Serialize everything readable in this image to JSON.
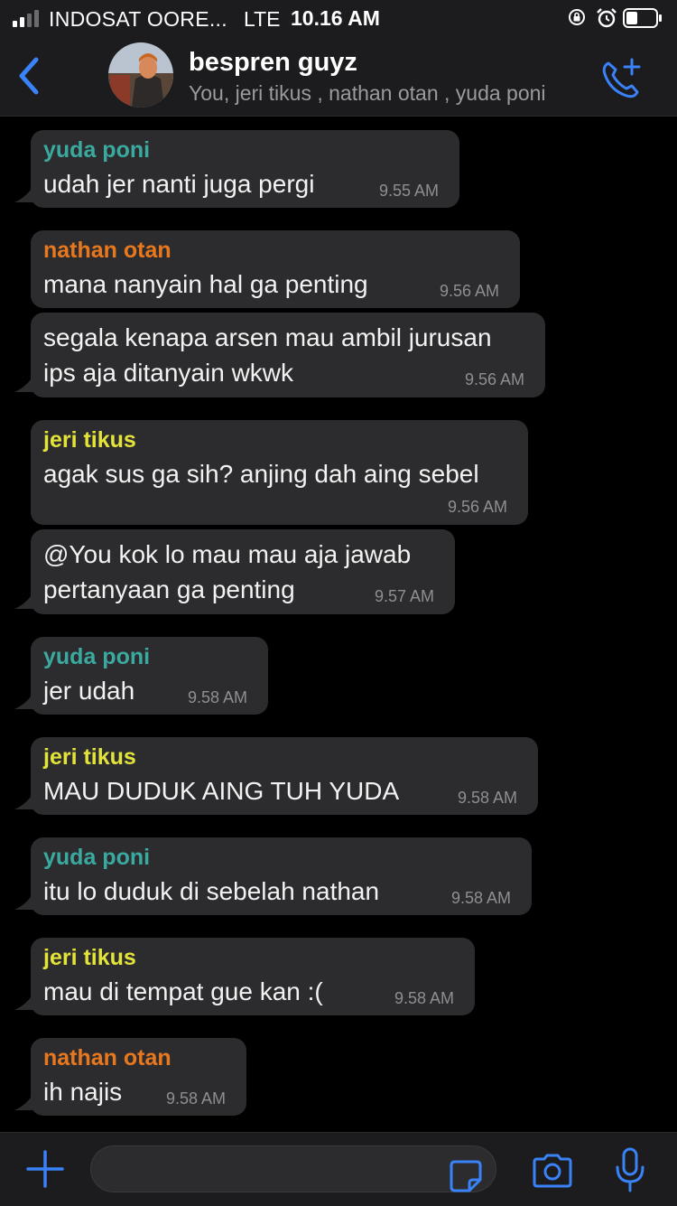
{
  "status_bar": {
    "carrier": "INDOSAT OORE...",
    "network": "LTE",
    "time": "10.16 AM"
  },
  "header": {
    "title": "bespren guyz",
    "members": "You, jeri tikus , nathan otan , yuda poni"
  },
  "colors": {
    "accent": "#3a82f7",
    "yuda_poni": "#3aa99f",
    "nathan_otan": "#e8781e",
    "jeri_tikus": "#e3e33a",
    "bubble": "#2c2c2e"
  },
  "messages": [
    {
      "sender": "yuda poni",
      "lines": [
        "udah jer nanti juga pergi"
      ],
      "time": "9.55 AM"
    },
    {
      "sender": "nathan otan",
      "lines": [
        "mana nanyain hal ga penting"
      ],
      "time": "9.56 AM"
    },
    {
      "sender": "",
      "lines": [
        "segala kenapa arsen mau ambil jurusan",
        "ips aja ditanyain wkwk"
      ],
      "time": "9.56 AM"
    },
    {
      "sender": "jeri tikus",
      "lines": [
        "agak sus ga sih? anjing dah aing sebel"
      ],
      "time": "9.56 AM"
    },
    {
      "sender": "",
      "lines": [
        "@You kok lo mau mau aja jawab",
        "pertanyaan ga penting"
      ],
      "time": "9.57 AM"
    },
    {
      "sender": "yuda poni",
      "lines": [
        "jer udah"
      ],
      "time": "9.58 AM"
    },
    {
      "sender": "jeri tikus",
      "lines": [
        "MAU DUDUK AING TUH YUDA"
      ],
      "time": "9.58 AM"
    },
    {
      "sender": "yuda poni",
      "lines": [
        "itu lo duduk di sebelah nathan"
      ],
      "time": "9.58 AM"
    },
    {
      "sender": "jeri tikus",
      "lines": [
        "mau di tempat gue kan :("
      ],
      "time": "9.58 AM"
    },
    {
      "sender": "nathan otan",
      "lines": [
        "ih najis"
      ],
      "time": "9.58 AM"
    }
  ],
  "input": {
    "placeholder": "",
    "value": ""
  }
}
